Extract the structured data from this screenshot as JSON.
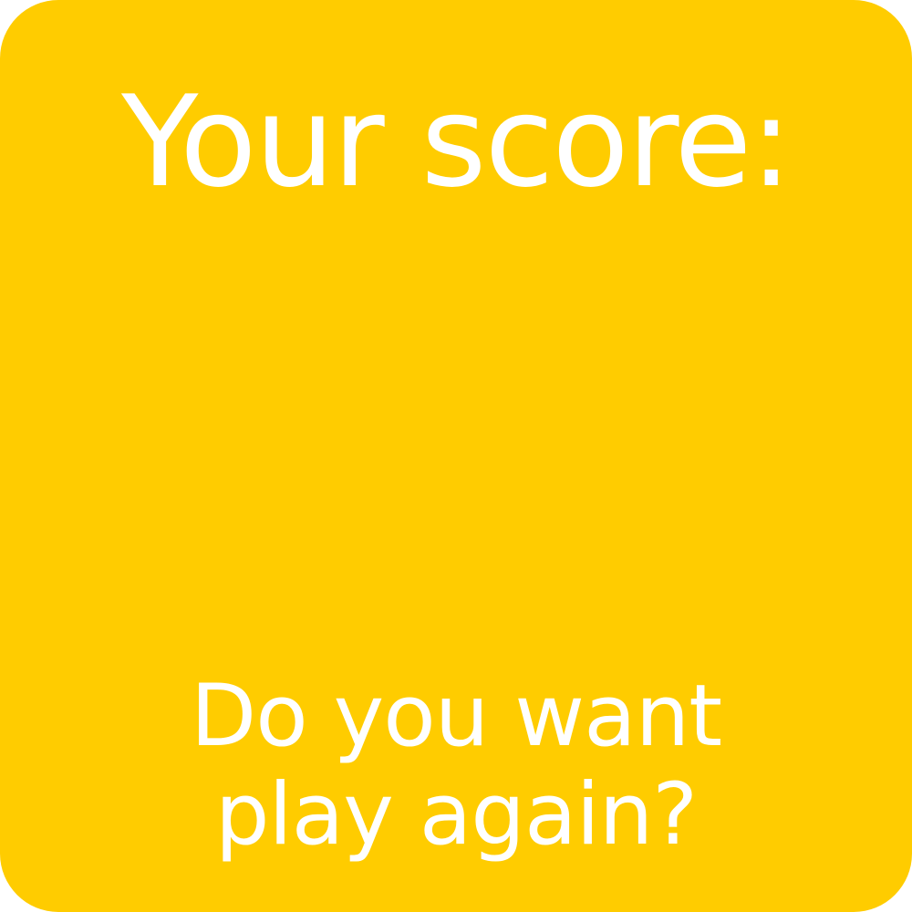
{
  "game": {
    "score_label": "Your score:",
    "score_value": "",
    "prompt_line1": "Do you want",
    "prompt_line2": "play again?"
  },
  "colors": {
    "background": "#FFCC00",
    "text": "#FFFFFF"
  }
}
